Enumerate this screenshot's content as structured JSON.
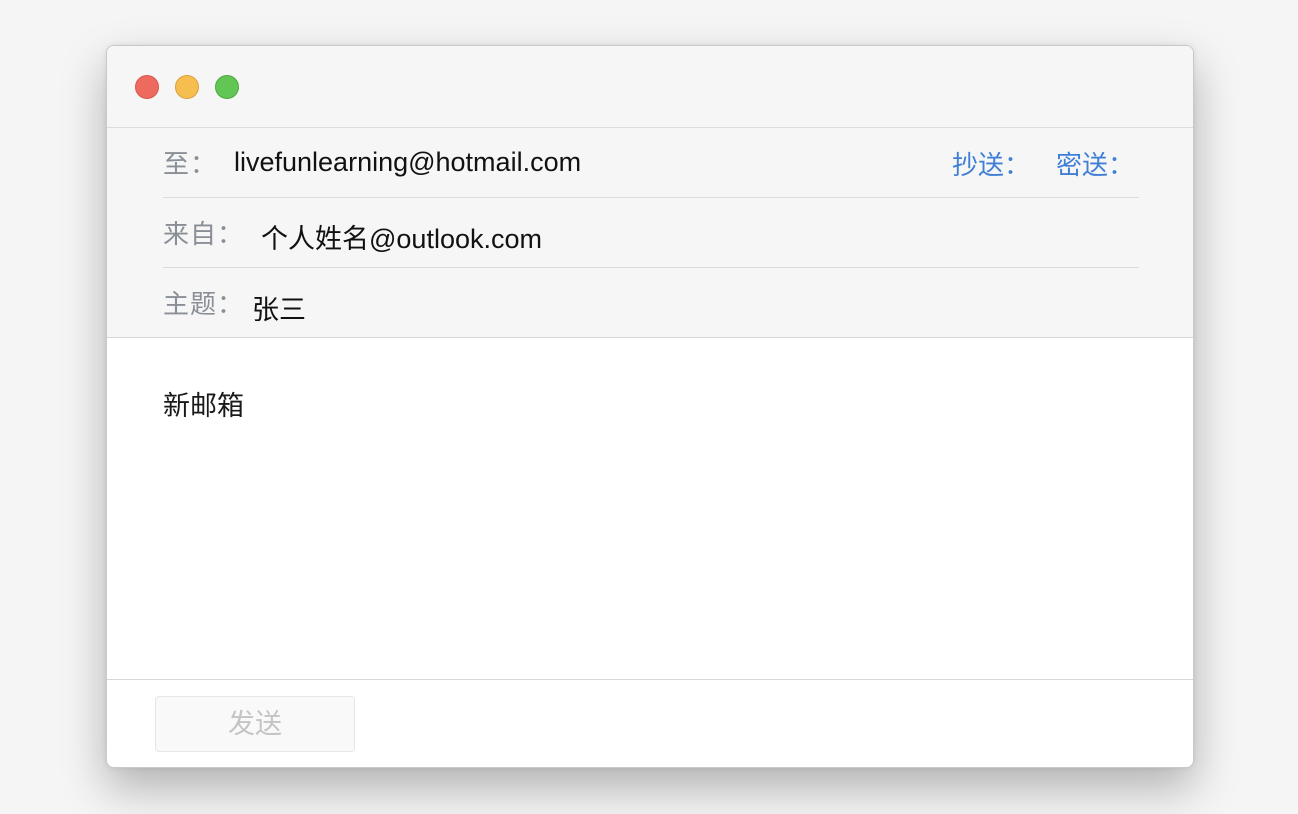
{
  "window": {
    "traffic_lights": {
      "close_color": "#ee6a5f",
      "minimize_color": "#f5be4f",
      "zoom_color": "#62c654"
    }
  },
  "compose": {
    "to": {
      "label": "至：",
      "value": "livefunlearning@hotmail.com"
    },
    "cc_label": "抄送：",
    "bcc_label": "密送：",
    "from": {
      "label": "来自：",
      "value": "个人姓名@outlook.com"
    },
    "subject": {
      "label": "主题：",
      "value": "张三"
    },
    "body": "新邮箱"
  },
  "footer": {
    "send_label": "发送",
    "send_enabled": false
  },
  "colors": {
    "link": "#3f7fd6",
    "label": "#8a8e96",
    "header_bg": "#f6f6f6"
  }
}
